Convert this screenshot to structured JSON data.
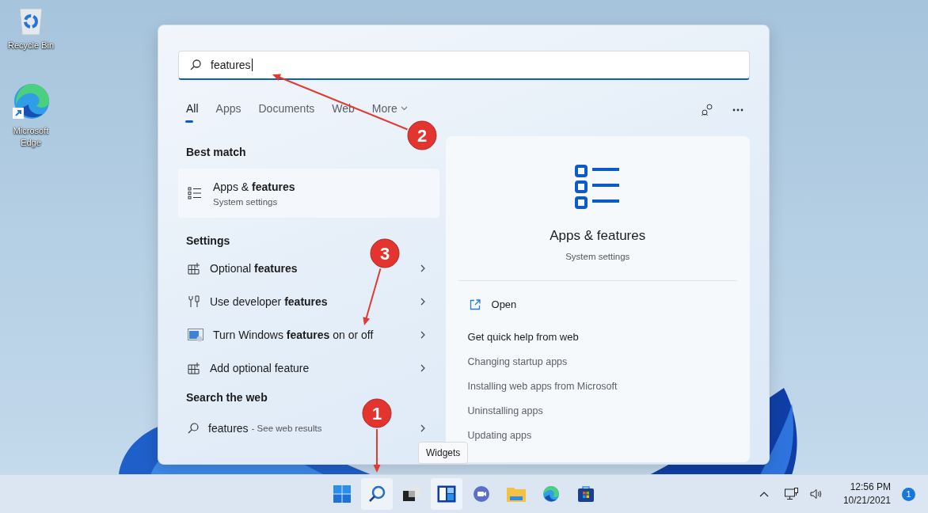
{
  "desktop_icons": [
    {
      "kind": "recycle",
      "label": "Recycle Bin"
    },
    {
      "kind": "edge",
      "label": "Microsoft Edge"
    }
  ],
  "search": {
    "value": "features"
  },
  "filters": [
    {
      "label": "All",
      "selected": true,
      "dropdown": false
    },
    {
      "label": "Apps",
      "selected": false,
      "dropdown": false
    },
    {
      "label": "Documents",
      "selected": false,
      "dropdown": false
    },
    {
      "label": "Web",
      "selected": false,
      "dropdown": false
    },
    {
      "label": "More",
      "selected": false,
      "dropdown": true
    }
  ],
  "best_match": {
    "heading": "Best match",
    "title": "Apps & **features**",
    "subtitle": "System settings",
    "selected": true
  },
  "settings": {
    "heading": "Settings",
    "items": [
      {
        "kind": "optional",
        "label": "Optional **features**"
      },
      {
        "kind": "developer",
        "label": "Use developer **features**"
      },
      {
        "kind": "windows",
        "label": "Turn Windows **features** on or off"
      },
      {
        "kind": "optional",
        "label": "Add optional feature"
      }
    ]
  },
  "web": {
    "heading": "Search the web",
    "query": "features",
    "hint": "- See web results"
  },
  "preview": {
    "title": "Apps & features",
    "subtitle": "System settings",
    "open": "Open",
    "help_heading": "Get quick help from web",
    "help_links": [
      "Changing startup apps",
      "Installing web apps from Microsoft",
      "Uninstalling apps",
      "Updating apps"
    ]
  },
  "tooltip": "Widgets",
  "taskbar": {
    "apps": [
      {
        "kind": "start",
        "selected": false
      },
      {
        "kind": "search",
        "selected": true
      },
      {
        "kind": "taskview",
        "selected": false
      },
      {
        "kind": "widgets",
        "selected": true
      },
      {
        "kind": "chat",
        "selected": false
      },
      {
        "kind": "explorer",
        "selected": false
      },
      {
        "kind": "edge",
        "selected": false
      },
      {
        "kind": "store",
        "selected": false
      }
    ],
    "time": "12:56 PM",
    "date": "10/21/2021",
    "badge": "1"
  },
  "annotations": [
    {
      "label": "1"
    },
    {
      "label": "2"
    },
    {
      "label": "3"
    }
  ]
}
